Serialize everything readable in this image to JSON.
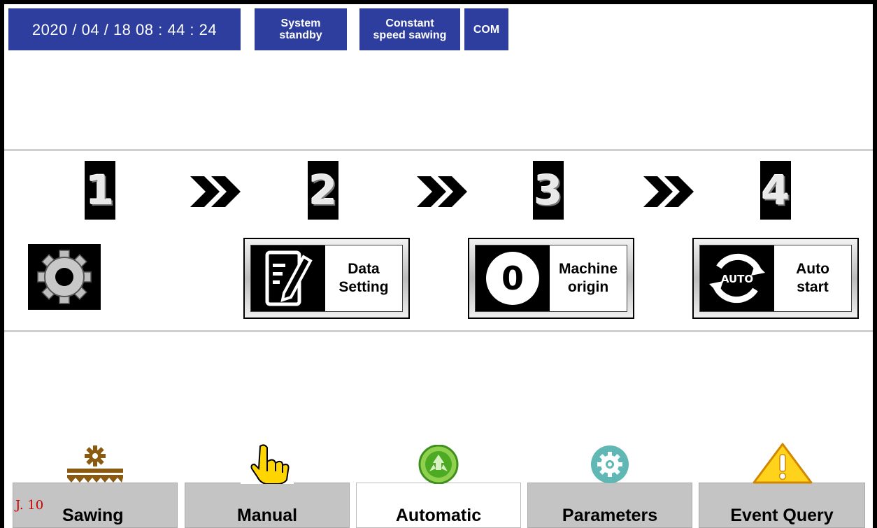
{
  "status_bar": {
    "datetime": "2020 / 04 / 18   08 : 44 : 24",
    "system_state_line1": "System",
    "system_state_line2": "standby",
    "sawing_mode_line1": "Constant",
    "sawing_mode_line2": "speed sawing",
    "com": "COM",
    "color": "#2d3e9f"
  },
  "steps": {
    "items": [
      "1",
      "2",
      "3",
      "4"
    ]
  },
  "actions": {
    "data_setting_line1": "Data",
    "data_setting_line2": "Setting",
    "machine_origin_icon_text": "0",
    "machine_origin_line1": "Machine",
    "machine_origin_line2": "origin",
    "auto_icon_text": "AUTO",
    "auto_start_line1": "Auto",
    "auto_start_line2": "start"
  },
  "bottom_nav": {
    "version": "J. 10",
    "sawing": "Sawing",
    "manual": "Manual",
    "automatic": "Automatic",
    "parameters": "Parameters",
    "event_query": "Event Query",
    "active": "Automatic"
  }
}
